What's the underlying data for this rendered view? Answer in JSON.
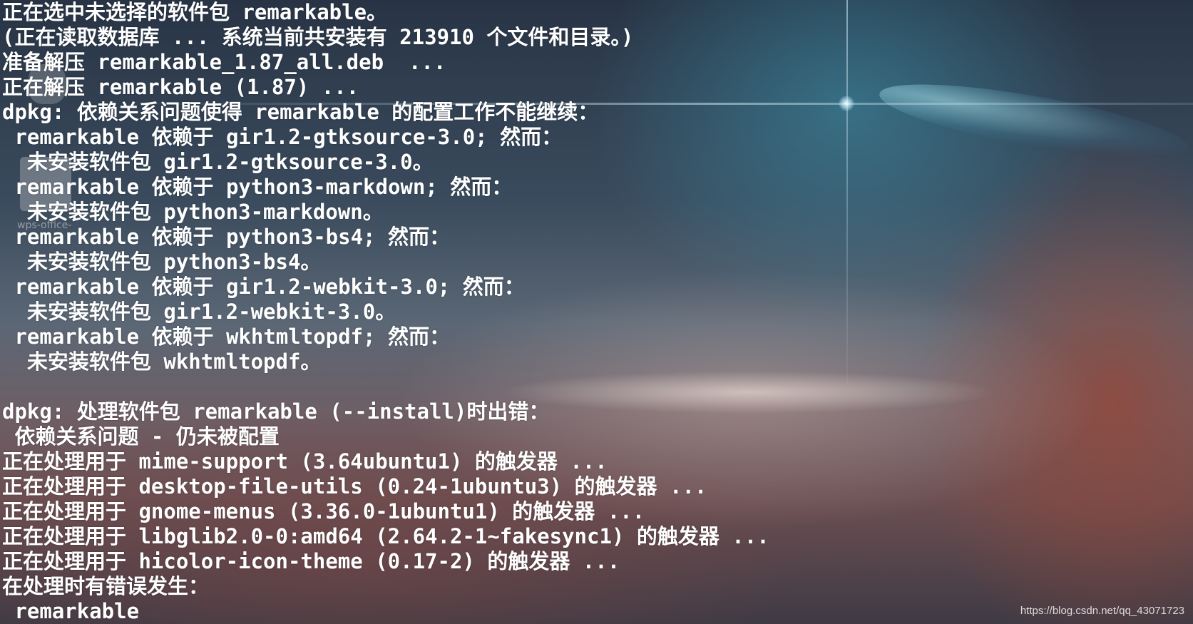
{
  "terminal": {
    "lines": [
      "正在选中未选择的软件包 remarkable。",
      "(正在读取数据库 ... 系统当前共安装有 213910 个文件和目录。)",
      "准备解压 remarkable_1.87_all.deb  ...",
      "正在解压 remarkable (1.87) ...",
      "dpkg: 依赖关系问题使得 remarkable 的配置工作不能继续：",
      " remarkable 依赖于 gir1.2-gtksource-3.0; 然而：",
      "  未安装软件包 gir1.2-gtksource-3.0。",
      " remarkable 依赖于 python3-markdown; 然而：",
      "  未安装软件包 python3-markdown。",
      " remarkable 依赖于 python3-bs4; 然而：",
      "  未安装软件包 python3-bs4。",
      " remarkable 依赖于 gir1.2-webkit-3.0; 然而：",
      "  未安装软件包 gir1.2-webkit-3.0。",
      " remarkable 依赖于 wkhtmltopdf; 然而：",
      "  未安装软件包 wkhtmltopdf。",
      "",
      "dpkg: 处理软件包 remarkable (--install)时出错：",
      " 依赖关系问题 - 仍未被配置",
      "正在处理用于 mime-support (3.64ubuntu1) 的触发器 ...",
      "正在处理用于 desktop-file-utils (0.24-1ubuntu3) 的触发器 ...",
      "正在处理用于 gnome-menus (3.36.0-1ubuntu1) 的触发器 ...",
      "正在处理用于 libglib2.0-0:amd64 (2.64.2-1~fakesync1) 的触发器 ...",
      "正在处理用于 hicolor-icon-theme (0.17-2) 的触发器 ...",
      "在处理时有错误发生：",
      " remarkable"
    ]
  },
  "desktop": {
    "icon_label": "wps-office-"
  },
  "watermark": {
    "text": "https://blog.csdn.net/qq_43071723"
  }
}
